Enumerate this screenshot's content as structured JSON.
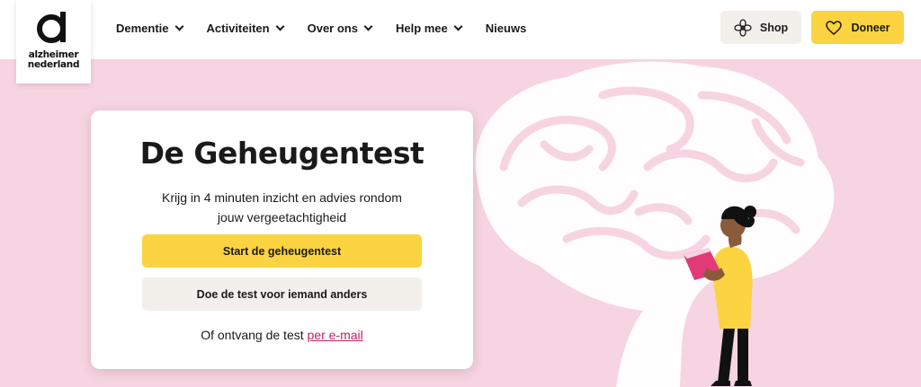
{
  "logo": {
    "line1": "alzheimer",
    "line2": "nederland"
  },
  "nav": {
    "items": [
      {
        "label": "Dementie",
        "dropdown": true
      },
      {
        "label": "Activiteiten",
        "dropdown": true
      },
      {
        "label": "Over ons",
        "dropdown": true
      },
      {
        "label": "Help mee",
        "dropdown": true
      },
      {
        "label": "Nieuws",
        "dropdown": false
      }
    ]
  },
  "actions": {
    "shop_label": "Shop",
    "shop_icon": "flower-icon",
    "donate_label": "Doneer",
    "donate_icon": "heart-icon"
  },
  "card": {
    "title": "De Geheugentest",
    "subtitle_line1": "Krijg in 4 minuten inzicht en advies rondom",
    "subtitle_line2": "jouw vergeetachtigheid",
    "primary_button": "Start de geheugentest",
    "secondary_button": "Doe de test voor iemand anders",
    "footer_text": "Of ontvang de test",
    "footer_link": "per e-mail"
  },
  "colors": {
    "background_pink": "#f7d4e1",
    "accent_yellow": "#fcd340",
    "neutral_button": "#f3efea",
    "link_pink": "#c4206a"
  }
}
